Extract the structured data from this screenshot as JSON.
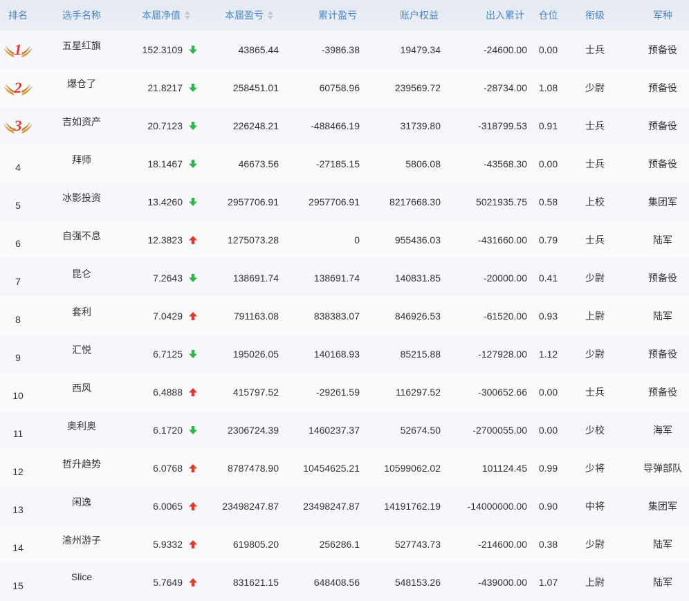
{
  "colors": {
    "header_text": "#4a86c8",
    "up": "#e23b2c",
    "down": "#2eb64a",
    "medal": "#c9963f"
  },
  "headers": {
    "rank": "排名",
    "name": "选手名称",
    "nav": "本届净值",
    "pnl": "本届盈亏",
    "cum": "累计盈亏",
    "equity": "账户权益",
    "flow": "出入累计",
    "position": "仓位",
    "rank_title": "衔级",
    "arm": "军种"
  },
  "rows": [
    {
      "rank": "1",
      "name": "五星红旗",
      "nav": "152.3109",
      "dir": "down",
      "pnl": "43865.44",
      "cum": "-3986.38",
      "equity": "19479.34",
      "flow": "-24600.00",
      "pos": "0.00",
      "title": "士兵",
      "arm": "预备役"
    },
    {
      "rank": "2",
      "name": "爆仓了",
      "nav": "21.8217",
      "dir": "down",
      "pnl": "258451.01",
      "cum": "60758.96",
      "equity": "239569.72",
      "flow": "-28734.00",
      "pos": "1.08",
      "title": "少尉",
      "arm": "预备役"
    },
    {
      "rank": "3",
      "name": "吉如资产",
      "nav": "20.7123",
      "dir": "down",
      "pnl": "226248.21",
      "cum": "-488466.19",
      "equity": "31739.80",
      "flow": "-318799.53",
      "pos": "0.91",
      "title": "士兵",
      "arm": "预备役"
    },
    {
      "rank": "4",
      "name": "拜师",
      "nav": "18.1467",
      "dir": "down",
      "pnl": "46673.56",
      "cum": "-27185.15",
      "equity": "5806.08",
      "flow": "-43568.30",
      "pos": "0.00",
      "title": "士兵",
      "arm": "预备役"
    },
    {
      "rank": "5",
      "name": "冰影投资",
      "nav": "13.4260",
      "dir": "down",
      "pnl": "2957706.91",
      "cum": "2957706.91",
      "equity": "8217668.30",
      "flow": "5021935.75",
      "pos": "0.58",
      "title": "上校",
      "arm": "集团军"
    },
    {
      "rank": "6",
      "name": "自强不息",
      "nav": "12.3823",
      "dir": "up",
      "pnl": "1275073.28",
      "cum": "0",
      "equity": "955436.03",
      "flow": "-431660.00",
      "pos": "0.79",
      "title": "士兵",
      "arm": "陆军"
    },
    {
      "rank": "7",
      "name": "昆仑",
      "nav": "7.2643",
      "dir": "down",
      "pnl": "138691.74",
      "cum": "138691.74",
      "equity": "140831.85",
      "flow": "-20000.00",
      "pos": "0.41",
      "title": "少尉",
      "arm": "预备役"
    },
    {
      "rank": "8",
      "name": "套利",
      "nav": "7.0429",
      "dir": "up",
      "pnl": "791163.08",
      "cum": "838383.07",
      "equity": "846926.53",
      "flow": "-61520.00",
      "pos": "0.93",
      "title": "上尉",
      "arm": "陆军"
    },
    {
      "rank": "9",
      "name": "汇悦",
      "nav": "6.7125",
      "dir": "down",
      "pnl": "195026.05",
      "cum": "140168.93",
      "equity": "85215.88",
      "flow": "-127928.00",
      "pos": "1.12",
      "title": "少尉",
      "arm": "预备役"
    },
    {
      "rank": "10",
      "name": "西风",
      "nav": "6.4888",
      "dir": "up",
      "pnl": "415797.52",
      "cum": "-29261.59",
      "equity": "116297.52",
      "flow": "-300652.66",
      "pos": "0.00",
      "title": "士兵",
      "arm": "预备役"
    },
    {
      "rank": "11",
      "name": "奥利奥",
      "nav": "6.1720",
      "dir": "down",
      "pnl": "2306724.39",
      "cum": "1460237.37",
      "equity": "52674.50",
      "flow": "-2700055.00",
      "pos": "0.00",
      "title": "少校",
      "arm": "海军"
    },
    {
      "rank": "12",
      "name": "哲升趋势",
      "nav": "6.0768",
      "dir": "up",
      "pnl": "8787478.90",
      "cum": "10454625.21",
      "equity": "10599062.02",
      "flow": "101124.45",
      "pos": "0.99",
      "title": "少将",
      "arm": "导弹部队"
    },
    {
      "rank": "13",
      "name": "闲逸",
      "nav": "6.0065",
      "dir": "up",
      "pnl": "23498247.87",
      "cum": "23498247.87",
      "equity": "14191762.19",
      "flow": "-14000000.00",
      "pos": "0.90",
      "title": "中将",
      "arm": "集团军"
    },
    {
      "rank": "14",
      "name": "渝州游子",
      "nav": "5.9332",
      "dir": "up",
      "pnl": "619805.20",
      "cum": "256286.1",
      "equity": "527743.73",
      "flow": "-214600.00",
      "pos": "0.38",
      "title": "少尉",
      "arm": "陆军"
    },
    {
      "rank": "15",
      "name": "Slice",
      "nav": "5.7649",
      "dir": "up",
      "pnl": "831621.15",
      "cum": "648408.56",
      "equity": "548153.26",
      "flow": "-439000.00",
      "pos": "1.07",
      "title": "上尉",
      "arm": "陆军"
    }
  ]
}
